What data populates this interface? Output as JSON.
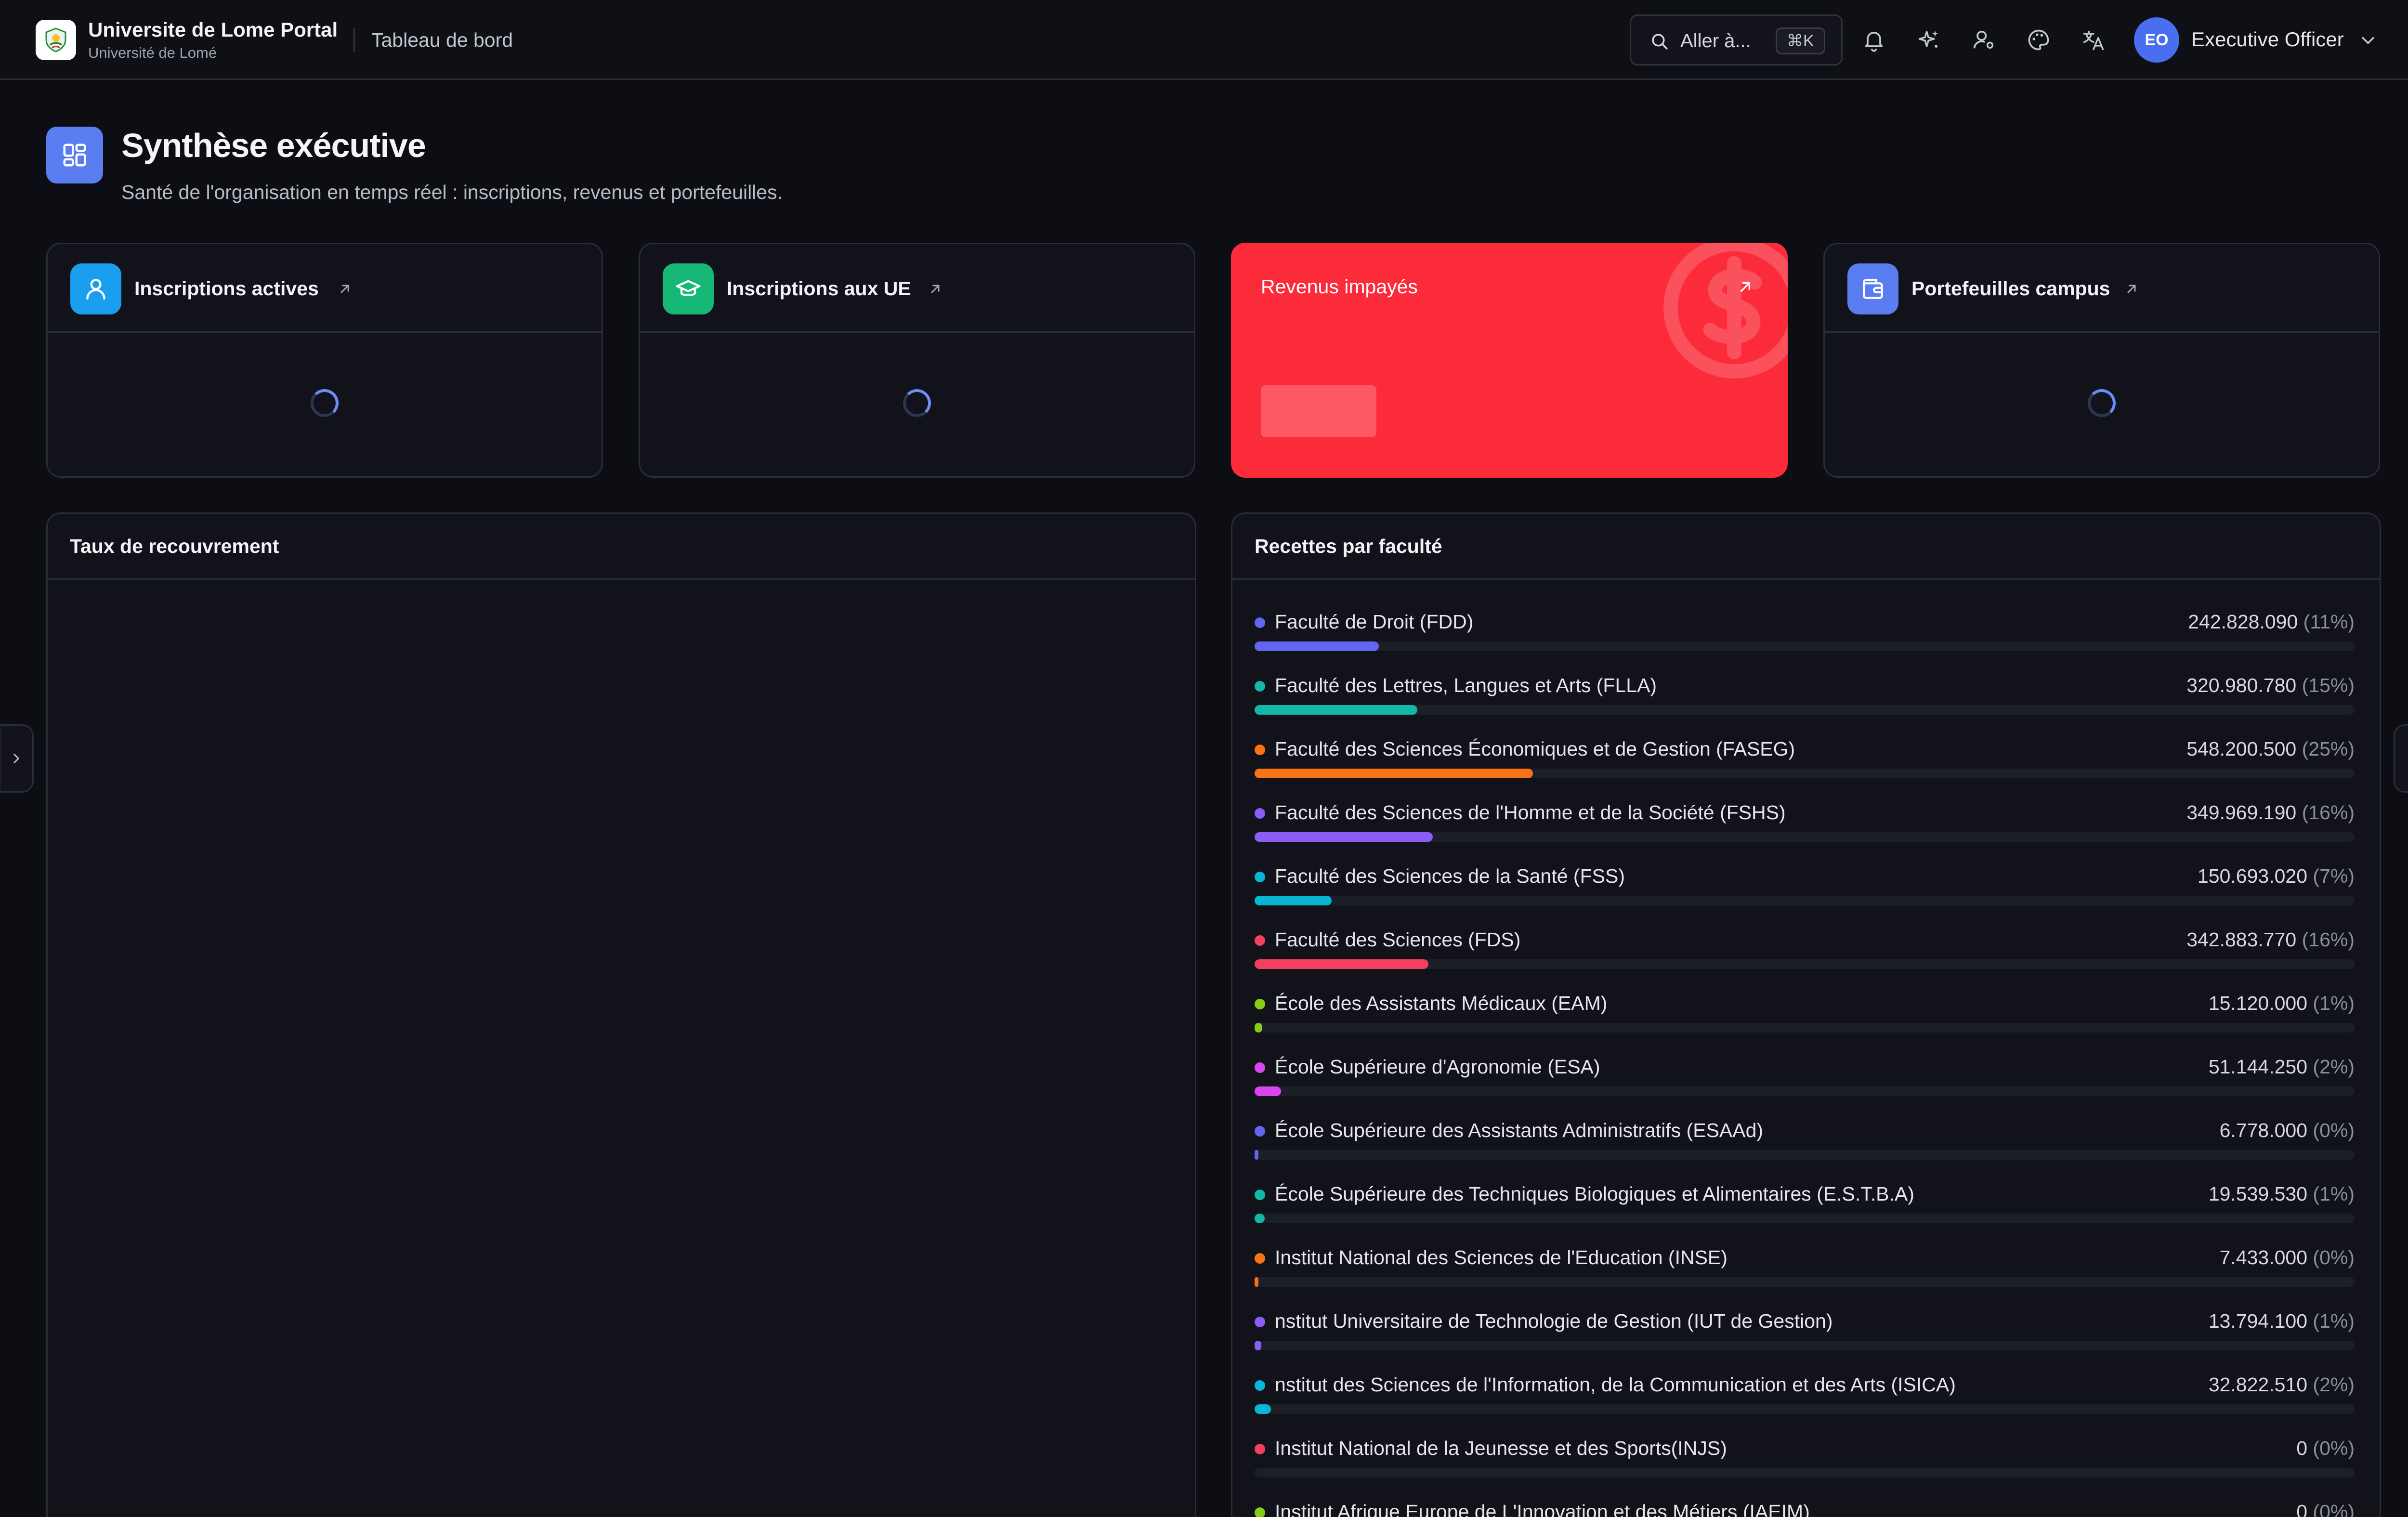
{
  "header": {
    "brand_title": "Universite de Lome Portal",
    "brand_subtitle": "Université de Lomé",
    "breadcrumb": "Tableau de bord",
    "search_label": "Aller à...",
    "search_shortcut": "⌘K",
    "icons": [
      "bell-icon",
      "sparkles-icon",
      "user-settings-icon",
      "palette-icon",
      "translate-icon"
    ],
    "user_initials": "EO",
    "user_name": "Executive Officer"
  },
  "page": {
    "title": "Synthèse exécutive",
    "subtitle": "Santé de l'organisation en temps réel : inscriptions, revenus et portefeuilles."
  },
  "cards": [
    {
      "title": "Inscriptions actives",
      "icon": "user-icon",
      "color": "#1a9ff0",
      "state": "loading"
    },
    {
      "title": "Inscriptions aux UE",
      "icon": "graduation-cap-icon",
      "color": "#16b877",
      "state": "loading"
    },
    {
      "title": "Revenus impayés",
      "icon": "dollar-icon",
      "color": "#fb2b3a",
      "state": "loading"
    },
    {
      "title": "Portefeuilles campus",
      "icon": "wallet-icon",
      "color": "#5a7df2",
      "state": "loading"
    }
  ],
  "recovery_panel": {
    "title": "Taux de recouvrement"
  },
  "faculty_panel": {
    "title": "Recettes par faculté",
    "rows": [
      {
        "name": "Faculté de Droit (FDD)",
        "amount": "242.828.090",
        "pct": "(11%)",
        "share": 0.113,
        "color": "#6366f1"
      },
      {
        "name": "Faculté des Lettres, Langues et Arts (FLLA)",
        "amount": "320.980.780",
        "pct": "(15%)",
        "share": 0.148,
        "color": "#14b8a6"
      },
      {
        "name": "Faculté des Sciences Économiques et de Gestion (FASEG)",
        "amount": "548.200.500",
        "pct": "(25%)",
        "share": 0.253,
        "color": "#f97316"
      },
      {
        "name": "Faculté des Sciences de l'Homme et de la Société (FSHS)",
        "amount": "349.969.190",
        "pct": "(16%)",
        "share": 0.162,
        "color": "#8b5cf6"
      },
      {
        "name": "Faculté des Sciences de la Santé (FSS)",
        "amount": "150.693.020",
        "pct": "(7%)",
        "share": 0.07,
        "color": "#06b6d4"
      },
      {
        "name": "Faculté des Sciences (FDS)",
        "amount": "342.883.770",
        "pct": "(16%)",
        "share": 0.158,
        "color": "#f43f5e"
      },
      {
        "name": "École des Assistants Médicaux (EAM)",
        "amount": "15.120.000",
        "pct": "(1%)",
        "share": 0.007,
        "color": "#84cc16"
      },
      {
        "name": "École Supérieure d'Agronomie (ESA)",
        "amount": "51.144.250",
        "pct": "(2%)",
        "share": 0.024,
        "color": "#d946ef"
      },
      {
        "name": "École Supérieure des Assistants Administratifs (ESAAd)",
        "amount": "6.778.000",
        "pct": "(0%)",
        "share": 0.003,
        "color": "#6366f1"
      },
      {
        "name": "École Supérieure des Techniques Biologiques et Alimentaires (E.S.T.B.A)",
        "amount": "19.539.530",
        "pct": "(1%)",
        "share": 0.009,
        "color": "#14b8a6"
      },
      {
        "name": "Institut National des Sciences de l'Education (INSE)",
        "amount": "7.433.000",
        "pct": "(0%)",
        "share": 0.003,
        "color": "#f97316"
      },
      {
        "name": "nstitut Universitaire de Technologie de Gestion (IUT de Gestion)",
        "amount": "13.794.100",
        "pct": "(1%)",
        "share": 0.006,
        "color": "#8b5cf6"
      },
      {
        "name": "nstitut des Sciences de l'Information, de la Communication et des Arts (ISICA)",
        "amount": "32.822.510",
        "pct": "(2%)",
        "share": 0.015,
        "color": "#06b6d4"
      },
      {
        "name": "Institut National de la Jeunesse et des Sports(INJS)",
        "amount": "0",
        "pct": "(0%)",
        "share": 0,
        "color": "#f43f5e"
      },
      {
        "name": "Institut Afrique Europe de L'Innovation et des Métiers (IAEIM)",
        "amount": "0",
        "pct": "(0%)",
        "share": 0,
        "color": "#84cc16"
      }
    ]
  }
}
